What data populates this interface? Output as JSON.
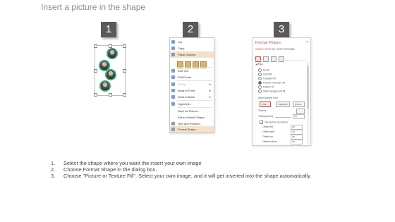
{
  "title": "Insert a picture in the shape",
  "badges": [
    "1",
    "2",
    "3"
  ],
  "context_menu": {
    "items": [
      {
        "label": "Cut",
        "state": "normal"
      },
      {
        "label": "Copy",
        "state": "normal"
      },
      {
        "label": "Paste Options:",
        "state": "highlight"
      },
      {
        "label": "Edit Text",
        "state": "normal"
      },
      {
        "label": "Edit Points",
        "state": "normal"
      },
      {
        "label": "Group",
        "state": "disabled",
        "submenu": true
      },
      {
        "label": "Bring to Front",
        "state": "normal",
        "submenu": true
      },
      {
        "label": "Send to Back",
        "state": "normal",
        "submenu": true
      },
      {
        "label": "Hyperlink...",
        "state": "normal"
      },
      {
        "label": "Save as Picture...",
        "state": "normal"
      },
      {
        "label": "Set as Default Shape",
        "state": "normal"
      },
      {
        "label": "Size and Position...",
        "state": "normal"
      },
      {
        "label": "Format Shape...",
        "state": "highlight"
      }
    ],
    "submenu_arrow": "►"
  },
  "format_pane": {
    "title": "Format Picture",
    "close": "×",
    "tabs": [
      "SHAPE OPTIONS",
      "TEXT OPTIONS"
    ],
    "fill_header": "◢ FILL",
    "fill_options": [
      {
        "label": "No fill",
        "selected": false
      },
      {
        "label": "Solid fill",
        "selected": false
      },
      {
        "label": "Gradient fill",
        "selected": false
      },
      {
        "label": "Picture or texture fill",
        "selected": true
      },
      {
        "label": "Pattern fill",
        "selected": false
      },
      {
        "label": "Slide background fill",
        "selected": false
      }
    ],
    "insert_from_label": "Insert picture from",
    "buttons": [
      "File...",
      "Clipboard",
      "Online..."
    ],
    "texture_label": "Texture",
    "transparency_label": "Transparency",
    "transparency_value": "0%",
    "tile_label": "Tile picture as texture",
    "offsets": [
      {
        "label": "Offset left",
        "value": "0%"
      },
      {
        "label": "Offset right",
        "value": "0%"
      },
      {
        "label": "Offset top",
        "value": "0%"
      },
      {
        "label": "Offset bottom",
        "value": "0%"
      }
    ]
  },
  "instructions": [
    {
      "num": "1.",
      "text": "Select the shape where you want the insert your own image"
    },
    {
      "num": "2.",
      "text": "Choose Format Shape in the dialog box."
    },
    {
      "num": "3.",
      "text": "Choose \"Picture or Texture Fill\". Select your own image, and it will get inserted into the shape automatically."
    }
  ],
  "colors": {
    "badge": "#595959",
    "accent": "#c0504d",
    "photo_ring": "#3aa57d",
    "menu_highlight": "#f2e2c8"
  }
}
